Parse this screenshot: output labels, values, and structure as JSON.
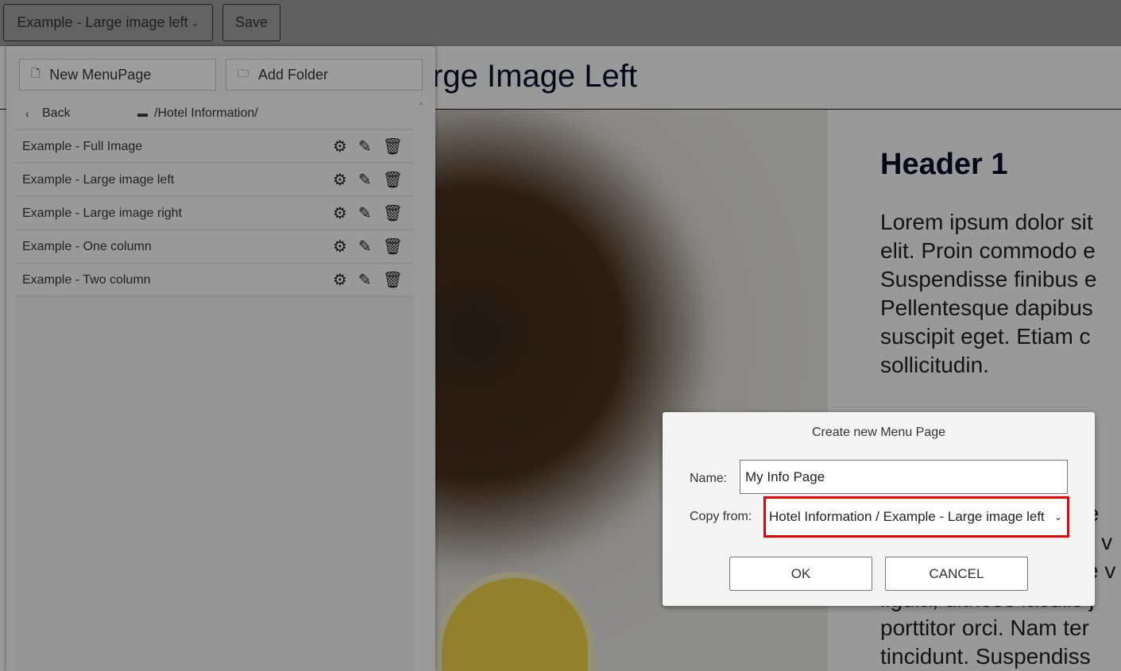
{
  "toolbar": {
    "page_select": "Example - Large image left",
    "save_label": "Save"
  },
  "page": {
    "title": "Example - Large Image Left",
    "header": "Header 1",
    "paragraph1": [
      "Lorem ipsum dolor sit",
      "elit. Proin commodo e",
      "Suspendisse finibus e",
      "Pellentesque dapibus",
      "suscipit eget. Etiam c",
      "sollicitudin."
    ],
    "paragraph2": [
      "fe",
      "r v",
      "e v",
      "ligula, ultrices iaculis j",
      "porttitor orci. Nam ter",
      "tincidunt. Suspendiss"
    ]
  },
  "panel": {
    "new_page_label": "New MenuPage",
    "add_folder_label": "Add Folder",
    "back_label": "Back",
    "path": "/Hotel Information/",
    "items": [
      {
        "label": "Example - Full Image"
      },
      {
        "label": "Example - Large image left"
      },
      {
        "label": "Example - Large image right"
      },
      {
        "label": "Example - One column"
      },
      {
        "label": "Example - Two column"
      }
    ]
  },
  "dialog": {
    "title": "Create new Menu Page",
    "name_label": "Name:",
    "name_value": "My Info Page",
    "copy_label": "Copy from:",
    "copy_value": "Hotel Information / Example - Large image left",
    "ok_label": "OK",
    "cancel_label": "CANCEL",
    "highlight_color": "#e00000"
  }
}
